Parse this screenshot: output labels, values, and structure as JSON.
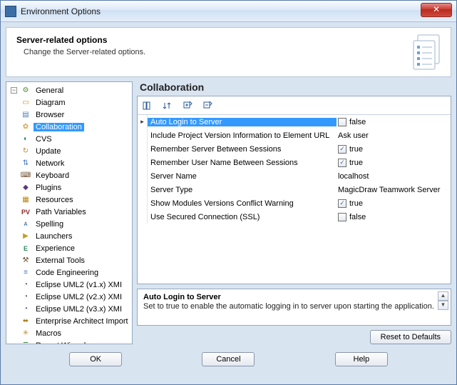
{
  "window": {
    "title": "Environment Options"
  },
  "header": {
    "title": "Server-related options",
    "subtitle": "Change the Server-related options."
  },
  "tree": [
    {
      "label": "General",
      "icon": "⚙",
      "c": "#5b8a3a"
    },
    {
      "label": "Diagram",
      "icon": "▭",
      "c": "#d98c1a"
    },
    {
      "label": "Browser",
      "icon": "▤",
      "c": "#4a7bbf"
    },
    {
      "label": "Collaboration",
      "icon": "✿",
      "c": "#d9a441",
      "sel": true
    },
    {
      "label": "CVS",
      "icon": "◐",
      "c": "#2e8b57"
    },
    {
      "label": "Update",
      "icon": "↻",
      "c": "#c08a2a"
    },
    {
      "label": "Network",
      "icon": "⇅",
      "c": "#4a7bbf"
    },
    {
      "label": "Keyboard",
      "icon": "⌨",
      "c": "#6b4a2a"
    },
    {
      "label": "Plugins",
      "icon": "◆",
      "c": "#5a3a7a"
    },
    {
      "label": "Resources",
      "icon": "▦",
      "c": "#b8860b"
    },
    {
      "label": "Path Variables",
      "icon": "PV",
      "c": "#8a2a2a",
      "txt": true
    },
    {
      "label": "Spelling",
      "icon": "ᴀ",
      "c": "#2a6a9a"
    },
    {
      "label": "Launchers",
      "icon": "▶",
      "c": "#c0a020"
    },
    {
      "label": "Experience",
      "icon": "E",
      "c": "#2a8a5a",
      "txt": true
    },
    {
      "label": "External Tools",
      "icon": "⚒",
      "c": "#6a4a2a"
    },
    {
      "label": "Code Engineering",
      "icon": "≡",
      "c": "#4a7bbf"
    },
    {
      "label": "Eclipse UML2 (v1.x) XMI",
      "icon": "◔",
      "c": "#5a3a8a"
    },
    {
      "label": "Eclipse UML2 (v2.x) XMI",
      "icon": "◔",
      "c": "#5a3a8a"
    },
    {
      "label": "Eclipse UML2 (v3.x) XMI",
      "icon": "◔",
      "c": "#5a3a8a"
    },
    {
      "label": "Enterprise Architect Import",
      "icon": "⬌",
      "c": "#b08020"
    },
    {
      "label": "Macros",
      "icon": "✳",
      "c": "#c08a2a"
    },
    {
      "label": "Report Wizard",
      "icon": "≣",
      "c": "#3a7a3a"
    }
  ],
  "section": {
    "title": "Collaboration"
  },
  "props": [
    {
      "name": "Auto Login to Server",
      "kind": "bool",
      "value": "false",
      "checked": false,
      "sel": true
    },
    {
      "name": "Include Project Version Information to Element URL",
      "kind": "text",
      "value": "Ask user"
    },
    {
      "name": "Remember Server Between Sessions",
      "kind": "bool",
      "value": "true",
      "checked": true
    },
    {
      "name": "Remember User Name Between Sessions",
      "kind": "bool",
      "value": "true",
      "checked": true
    },
    {
      "name": "Server Name",
      "kind": "text",
      "value": "localhost"
    },
    {
      "name": "Server Type",
      "kind": "text",
      "value": "MagicDraw Teamwork Server"
    },
    {
      "name": "Show Modules Versions Conflict Warning",
      "kind": "bool",
      "value": "true",
      "checked": true
    },
    {
      "name": "Use Secured Connection (SSL)",
      "kind": "bool",
      "value": "false",
      "checked": false
    }
  ],
  "desc": {
    "title": "Auto Login to Server",
    "text": "Set to true to enable the automatic logging in to server upon starting the application."
  },
  "buttons": {
    "reset": "Reset to Defaults",
    "ok": "OK",
    "cancel": "Cancel",
    "help": "Help"
  }
}
